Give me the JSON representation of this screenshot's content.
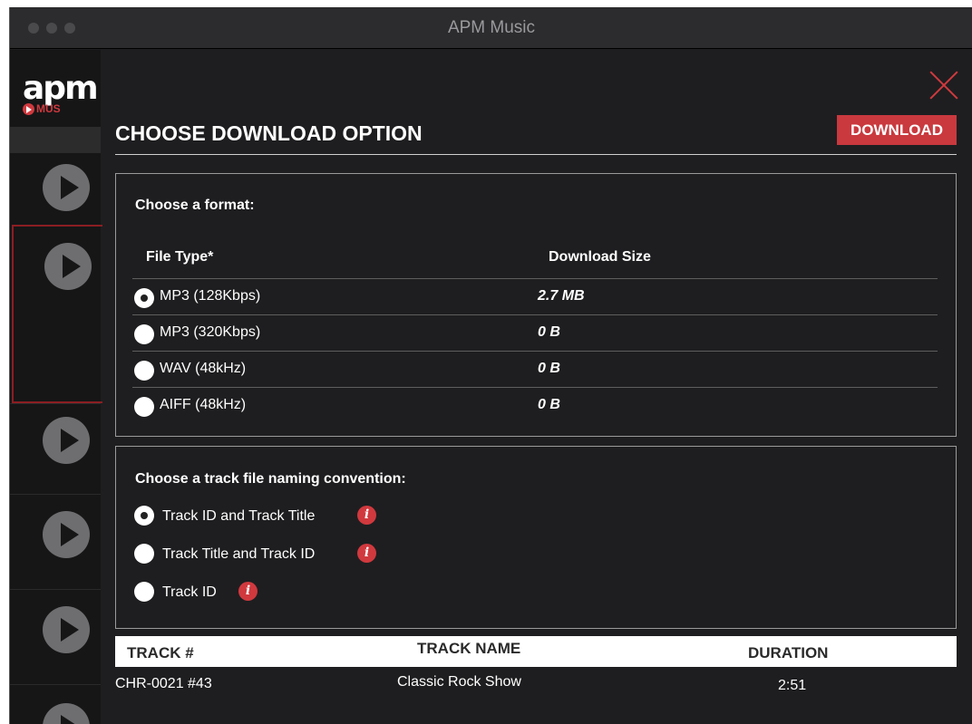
{
  "window": {
    "title": "APM Music"
  },
  "logo": {
    "main": "apm",
    "sub": "MUS"
  },
  "dialog": {
    "heading": "CHOOSE DOWNLOAD OPTION",
    "download_label": "DOWNLOAD",
    "format_section": {
      "title": "Choose a format:",
      "col_file_type": "File Type*",
      "col_download_size": "Download Size",
      "options": [
        {
          "label": "MP3 (128Kbps)",
          "size": "2.7 MB",
          "selected": true
        },
        {
          "label": "MP3 (320Kbps)",
          "size": "0 B",
          "selected": false
        },
        {
          "label": "WAV (48kHz)",
          "size": "0 B",
          "selected": false
        },
        {
          "label": "AIFF (48kHz)",
          "size": "0 B",
          "selected": false
        }
      ]
    },
    "naming_section": {
      "title": "Choose a track file naming convention:",
      "options": [
        {
          "label": "Track ID and Track Title",
          "selected": true
        },
        {
          "label": "Track Title and Track ID",
          "selected": false
        },
        {
          "label": "Track ID",
          "selected": false
        }
      ],
      "info_glyph": "i"
    },
    "tracks": {
      "headers": {
        "number": "TRACK #",
        "name": "TRACK NAME",
        "duration": "DURATION"
      },
      "rows": [
        {
          "number": "CHR-0021 #43",
          "name": "Classic Rock Show",
          "duration": "2:51"
        }
      ]
    }
  },
  "colors": {
    "accent": "#c9393e",
    "background": "#1e1e20",
    "sidebar": "#161617"
  },
  "icons": [
    "close-icon",
    "play-icon",
    "info-icon",
    "logo-play-icon"
  ]
}
